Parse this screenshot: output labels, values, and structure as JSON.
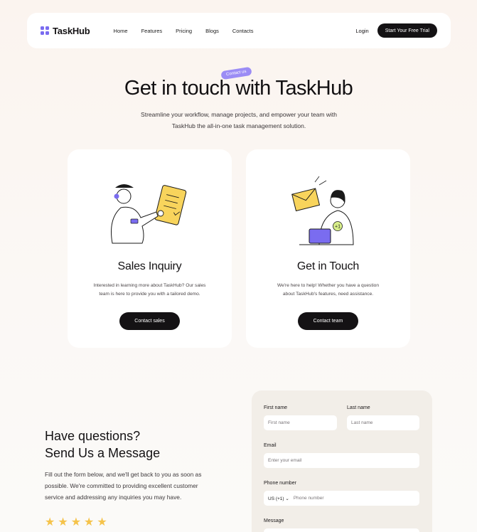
{
  "nav": {
    "logo": "TaskHub",
    "links": [
      "Home",
      "Features",
      "Pricing",
      "Blogs",
      "Contacts"
    ],
    "login": "Login",
    "cta": "Start Your Free Trial"
  },
  "hero": {
    "tag": "Contact us",
    "title": "Get in touch with TaskHub",
    "subtitle_line1": "Streamline your workflow, manage projects, and empower your team with",
    "subtitle_line2": "TaskHub the all-in-one task management solution."
  },
  "cards": [
    {
      "title": "Sales Inquiry",
      "desc_line1": "Interested in learning more about TaskHub? Our sales",
      "desc_line2": "team is here to provide you with a tailored demo.",
      "button": "Contact sales"
    },
    {
      "title": "Get in Touch",
      "desc_line1": "We're here to help! Whether you have a question",
      "desc_line2": "about TaskHub's features, need assistance.",
      "button": "Contact team",
      "badge": "+1"
    }
  ],
  "questions": {
    "title_line1": "Have questions?",
    "title_line2": "Send Us a Message",
    "desc_line1": "Fill out the form below, and we'll get back to you as soon as",
    "desc_line2": "possible. We're committed to providing excellent customer",
    "desc_line3": "service and addressing any inquiries you may have.",
    "rating": 5
  },
  "form": {
    "first_name_label": "First name",
    "first_name_placeholder": "First name",
    "last_name_label": "Last name",
    "last_name_placeholder": "Last name",
    "email_label": "Email",
    "email_placeholder": "Enter your email",
    "phone_label": "Phone number",
    "country_code": "US (+1)",
    "phone_placeholder": "Phone number",
    "message_label": "Message"
  },
  "colors": {
    "accent": "#7a6cf0",
    "dark": "#141214",
    "star": "#f5c34b",
    "note": "#f8d45c"
  }
}
